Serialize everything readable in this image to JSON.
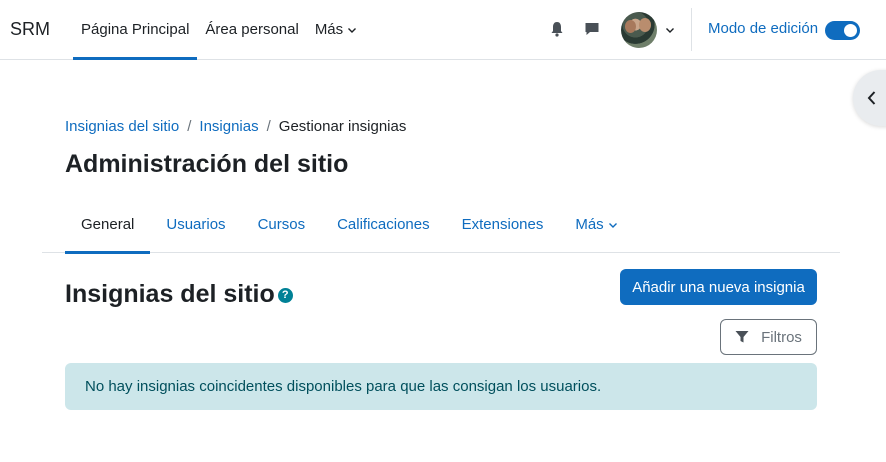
{
  "navbar": {
    "brand": "SRM",
    "items": [
      {
        "label": "Página Principal",
        "active": true
      },
      {
        "label": "Área personal",
        "active": false
      },
      {
        "label": "Más",
        "active": false
      }
    ],
    "edit_mode_label": "Modo de edición",
    "edit_mode_on": true
  },
  "breadcrumb": {
    "items": [
      "Insignias del sitio",
      "Insignias"
    ],
    "current": "Gestionar insignias",
    "separator": "/"
  },
  "page_title": "Administración del sitio",
  "tabs": [
    {
      "label": "General",
      "active": true
    },
    {
      "label": "Usuarios",
      "active": false
    },
    {
      "label": "Cursos",
      "active": false
    },
    {
      "label": "Calificaciones",
      "active": false
    },
    {
      "label": "Extensiones",
      "active": false
    },
    {
      "label": "Más",
      "active": false
    }
  ],
  "section": {
    "title": "Insignias del sitio",
    "help_glyph": "?",
    "add_button": "Añadir una nueva insignia",
    "filter_button": "Filtros",
    "alert": "No hay insignias coincidentes disponibles para que las consigan los usuarios."
  },
  "colors": {
    "primary": "#0f6cbf",
    "alert_bg": "#cce6ea",
    "alert_text": "#004f5c",
    "help": "#008196"
  }
}
